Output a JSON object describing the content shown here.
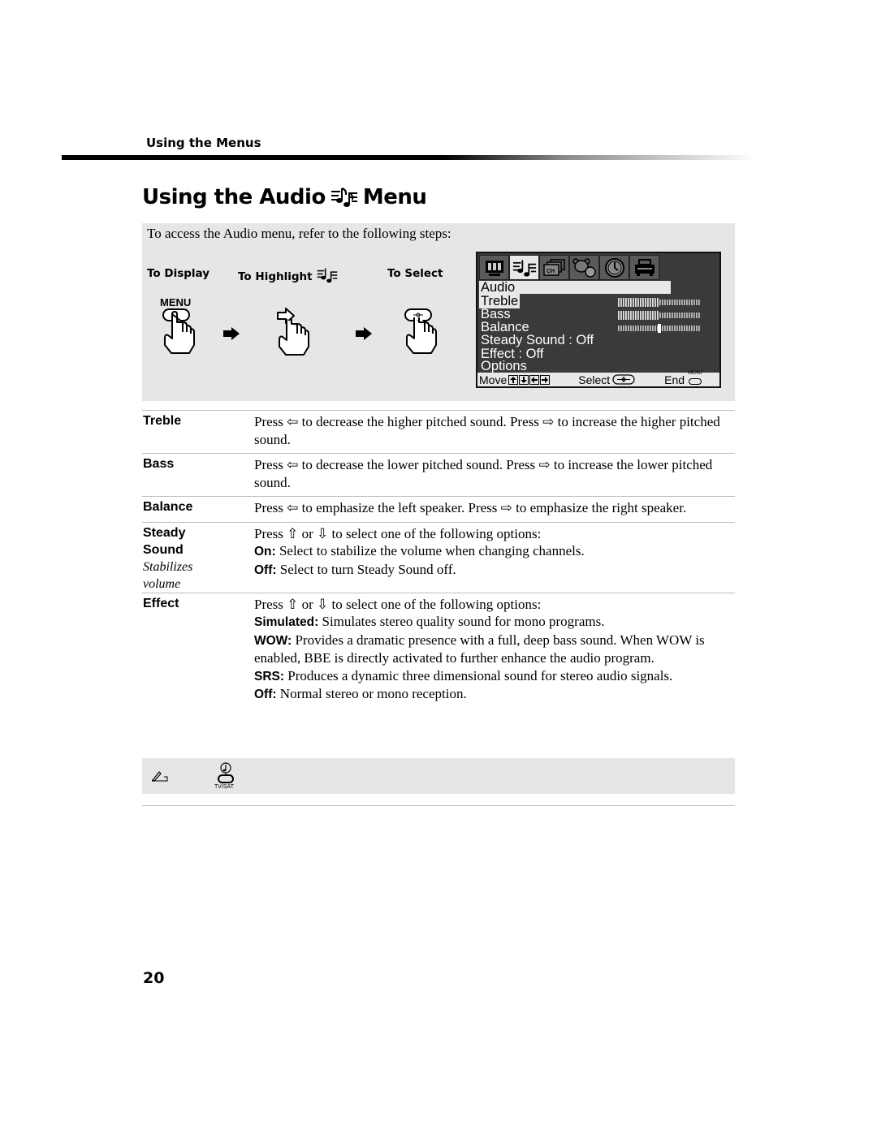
{
  "section_header": "Using the Menus",
  "title": {
    "prefix": "Using the Audio",
    "icon": "audio-notes-icon",
    "suffix": "Menu"
  },
  "steps": {
    "intro": "To access the Audio menu, refer to the following steps:",
    "to_display": "To Display",
    "to_highlight": "To Highlight",
    "to_select": "To Select",
    "menu_button_label": "MENU"
  },
  "tv_menu": {
    "tabs": [
      "video-icon",
      "audio-icon",
      "channel-icon",
      "parent-icon",
      "timer-icon",
      "setup-icon"
    ],
    "active_tab": 1,
    "title": "Audio",
    "items": [
      {
        "label": "Treble",
        "selected": true,
        "level": 0.5
      },
      {
        "label": "Bass",
        "level": 0.5
      },
      {
        "label": "Balance",
        "level": 0.5,
        "centered": true
      },
      {
        "label": "Steady Sound : Off"
      },
      {
        "label": "Effect : Off"
      },
      {
        "label": "Options"
      }
    ],
    "footer": {
      "move": "Move",
      "select": "Select",
      "end": "End",
      "end_button_label": "MENU"
    }
  },
  "descriptions": [
    {
      "term": "Treble",
      "lines": [
        "Press ⇦ to decrease the higher pitched sound. Press ⇨ to increase the higher pitched sound."
      ]
    },
    {
      "term": "Bass",
      "lines": [
        "Press ⇦ to decrease the lower pitched sound. Press ⇨ to increase the lower pitched sound."
      ]
    },
    {
      "term": "Balance",
      "lines": [
        "Press ⇦ to emphasize the left speaker. Press ⇨ to emphasize the right speaker."
      ]
    },
    {
      "term": "Steady",
      "term2": "Sound",
      "subtitle": "Stabilizes volume",
      "intro": "Press ⇧ or ⇩ to select one of the following options:",
      "options": [
        {
          "label": "On:",
          "text": " Select to stabilize the volume when changing channels."
        },
        {
          "label": "Off:",
          "text": " Select to turn Steady Sound off."
        }
      ]
    },
    {
      "term": "Effect",
      "intro": "Press ⇧ or ⇩ to select one of the following options:",
      "options": [
        {
          "label": "Simulated:",
          "text": " Simulates stereo quality sound for mono programs."
        },
        {
          "label": "WOW:",
          "text": " Provides a dramatic presence with a full, deep bass sound. When WOW is enabled, BBE is directly activated to further enhance the audio program."
        },
        {
          "label": "SRS:",
          "text": " Produces a dynamic three dimensional sound for stereo audio signals."
        },
        {
          "label": "Off:",
          "text": " Normal stereo or mono reception."
        }
      ]
    }
  ],
  "note": {
    "icon": "note-pencil-icon",
    "button_icon": "tv-sat-button-icon",
    "button_label": "TV/SAT"
  },
  "page_number": "20"
}
